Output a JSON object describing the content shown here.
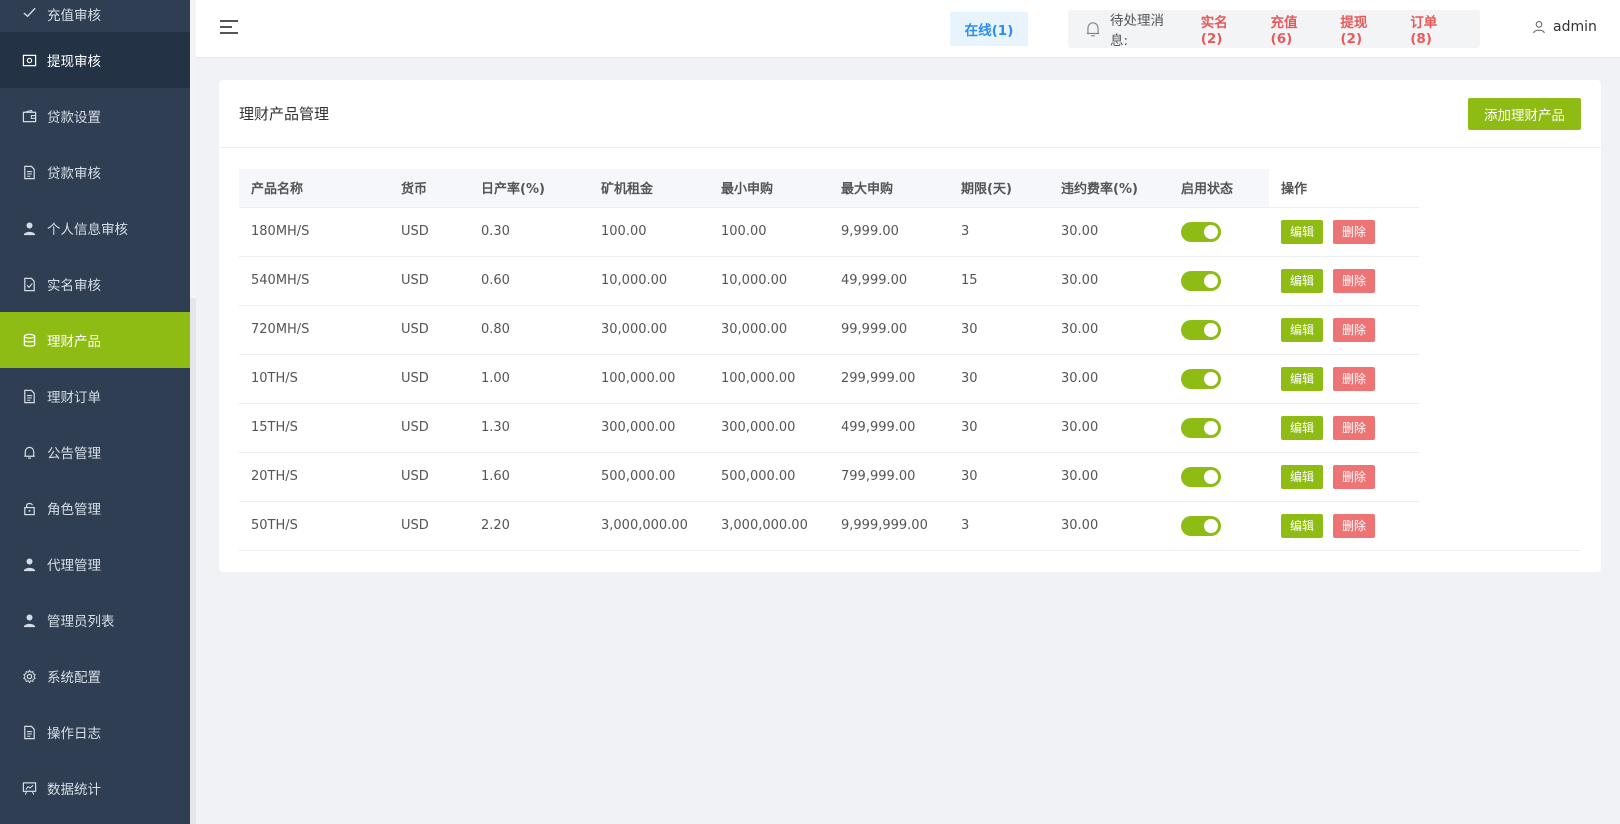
{
  "sidebar": {
    "items": [
      {
        "label": "充值审核",
        "icon": "check-icon",
        "state": "normal"
      },
      {
        "label": "提现审核",
        "icon": "money-icon",
        "state": "dark"
      },
      {
        "label": "贷款设置",
        "icon": "wallet-icon",
        "state": "normal"
      },
      {
        "label": "贷款审核",
        "icon": "document-icon",
        "state": "normal"
      },
      {
        "label": "个人信息审核",
        "icon": "user-icon",
        "state": "normal"
      },
      {
        "label": "实名审核",
        "icon": "document-check-icon",
        "state": "normal"
      },
      {
        "label": "理财产品",
        "icon": "database-icon",
        "state": "active"
      },
      {
        "label": "理财订单",
        "icon": "document-icon",
        "state": "normal"
      },
      {
        "label": "公告管理",
        "icon": "bell-icon",
        "state": "normal"
      },
      {
        "label": "角色管理",
        "icon": "lock-icon",
        "state": "normal"
      },
      {
        "label": "代理管理",
        "icon": "user-icon",
        "state": "normal"
      },
      {
        "label": "管理员列表",
        "icon": "user-icon",
        "state": "normal"
      },
      {
        "label": "系统配置",
        "icon": "gear-icon",
        "state": "normal"
      },
      {
        "label": "操作日志",
        "icon": "document-icon",
        "state": "normal"
      },
      {
        "label": "数据统计",
        "icon": "chart-board-icon",
        "state": "normal"
      }
    ]
  },
  "header": {
    "online": "在线(1)",
    "pending_label": "待处理消息:",
    "badges": [
      "实名(2)",
      "充值(6)",
      "提现(2)",
      "订单(8)"
    ],
    "username": "admin"
  },
  "card": {
    "title": "理财产品管理",
    "add_button": "添加理财产品"
  },
  "table": {
    "columns": [
      "产品名称",
      "货币",
      "日产率(%)",
      "矿机租金",
      "最小申购",
      "最大申购",
      "期限(天)",
      "违约费率(%)",
      "启用状态",
      "操作"
    ],
    "edit_label": "编辑",
    "delete_label": "删除",
    "rows": [
      {
        "name": "180MH/S",
        "currency": "USD",
        "rate": "0.30",
        "rent": "100.00",
        "min": "100.00",
        "max": "9,999.00",
        "term": "3",
        "penalty": "30.00",
        "enabled": true
      },
      {
        "name": "540MH/S",
        "currency": "USD",
        "rate": "0.60",
        "rent": "10,000.00",
        "min": "10,000.00",
        "max": "49,999.00",
        "term": "15",
        "penalty": "30.00",
        "enabled": true
      },
      {
        "name": "720MH/S",
        "currency": "USD",
        "rate": "0.80",
        "rent": "30,000.00",
        "min": "30,000.00",
        "max": "99,999.00",
        "term": "30",
        "penalty": "30.00",
        "enabled": true
      },
      {
        "name": "10TH/S",
        "currency": "USD",
        "rate": "1.00",
        "rent": "100,000.00",
        "min": "100,000.00",
        "max": "299,999.00",
        "term": "30",
        "penalty": "30.00",
        "enabled": true
      },
      {
        "name": "15TH/S",
        "currency": "USD",
        "rate": "1.30",
        "rent": "300,000.00",
        "min": "300,000.00",
        "max": "499,999.00",
        "term": "30",
        "penalty": "30.00",
        "enabled": true
      },
      {
        "name": "20TH/S",
        "currency": "USD",
        "rate": "1.60",
        "rent": "500,000.00",
        "min": "500,000.00",
        "max": "799,999.00",
        "term": "30",
        "penalty": "30.00",
        "enabled": true
      },
      {
        "name": "50TH/S",
        "currency": "USD",
        "rate": "2.20",
        "rent": "3,000,000.00",
        "min": "3,000,000.00",
        "max": "9,999,999.00",
        "term": "3",
        "penalty": "30.00",
        "enabled": true
      }
    ]
  },
  "colors": {
    "sidebar_bg": "#2f3e52",
    "accent": "#8fbc14",
    "danger": "#ee7374",
    "online_text": "#2d8cf0",
    "badge_text": "#e85a5a"
  }
}
